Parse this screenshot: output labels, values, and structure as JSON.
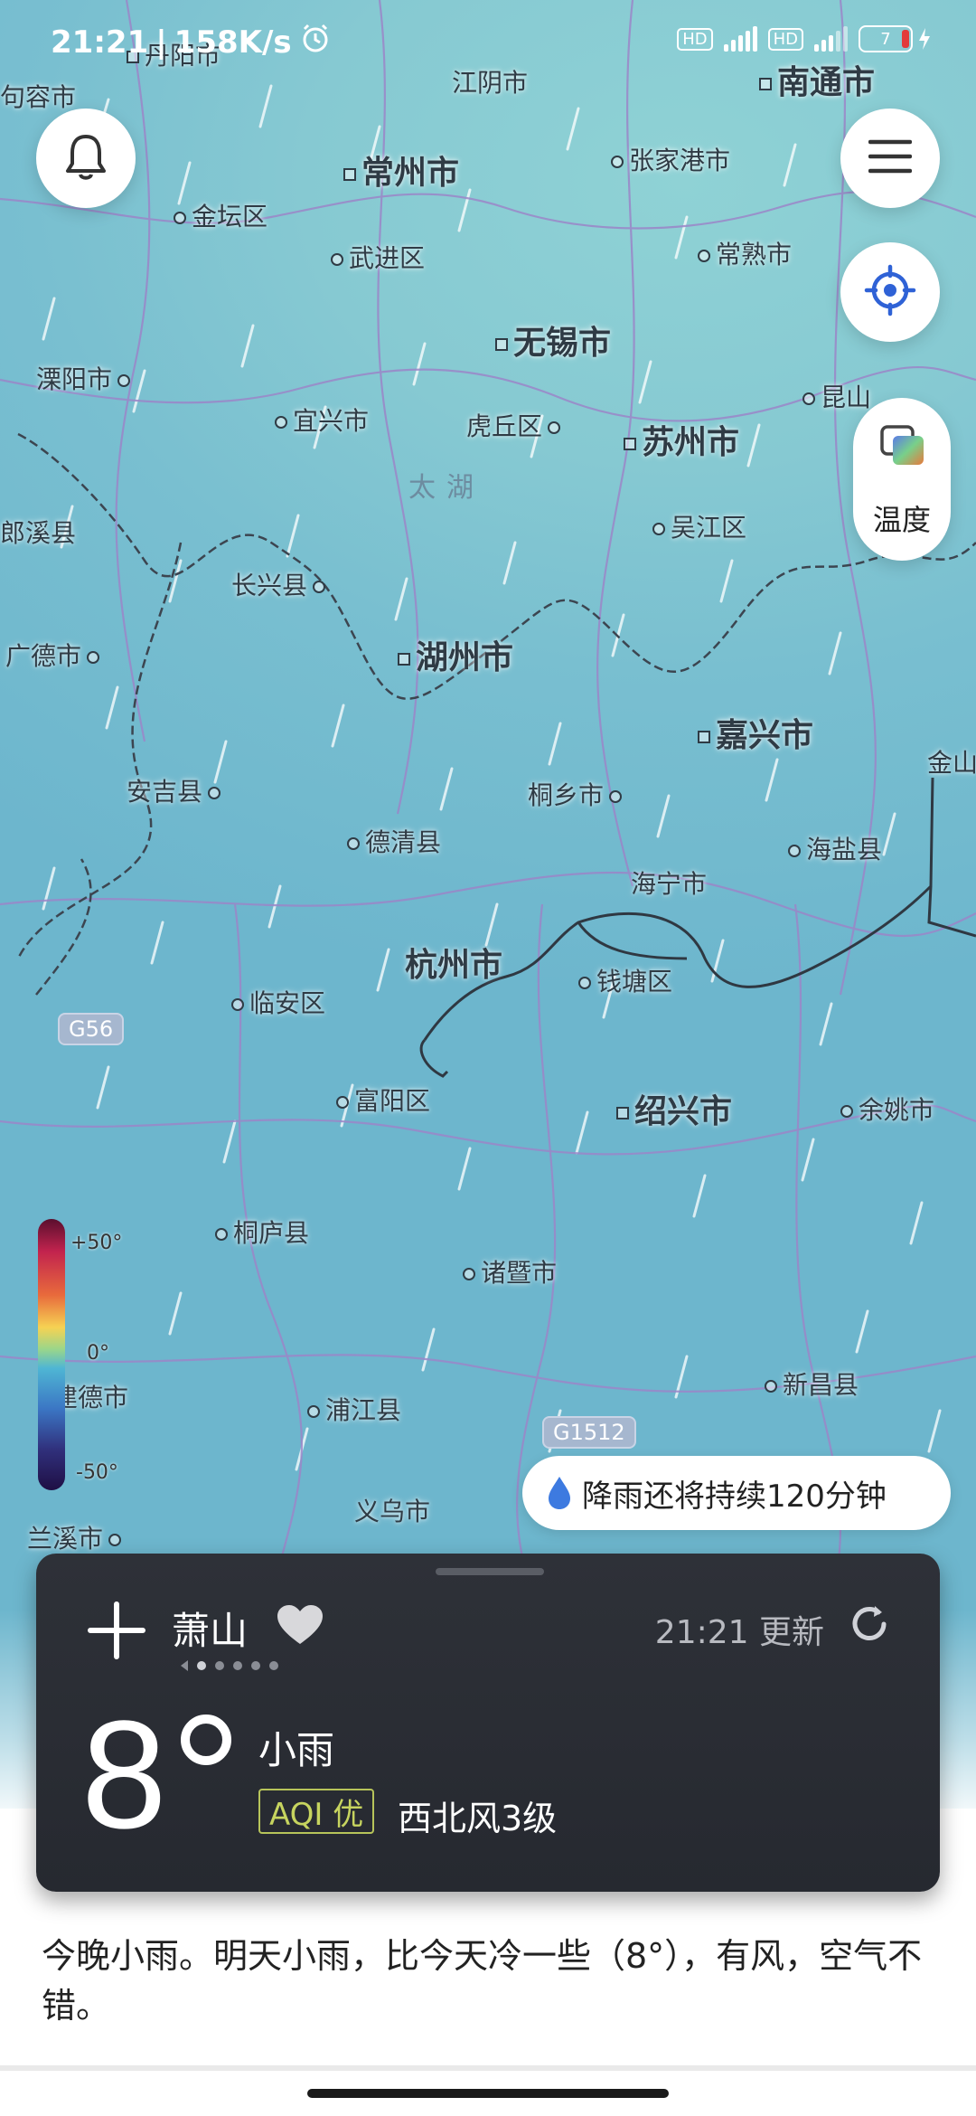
{
  "status_bar": {
    "time": "21:21",
    "speed": "158K/s",
    "battery": "7"
  },
  "map": {
    "places": [
      {
        "label": "丹阳市",
        "kind": "county"
      },
      {
        "label": "江阴市",
        "kind": "county"
      },
      {
        "label": "南通市",
        "kind": "city"
      },
      {
        "label": "句容市",
        "kind": "county"
      },
      {
        "label": "常州市",
        "kind": "city"
      },
      {
        "label": "张家港市",
        "kind": "county"
      },
      {
        "label": "金坛区",
        "kind": "county"
      },
      {
        "label": "武进区",
        "kind": "county"
      },
      {
        "label": "常熟市",
        "kind": "county"
      },
      {
        "label": "无锡市",
        "kind": "city"
      },
      {
        "label": "溧阳市",
        "kind": "county"
      },
      {
        "label": "宜兴市",
        "kind": "county"
      },
      {
        "label": "虎丘区",
        "kind": "county"
      },
      {
        "label": "苏州市",
        "kind": "city"
      },
      {
        "label": "昆山",
        "kind": "county"
      },
      {
        "label": "太湖",
        "kind": "lake"
      },
      {
        "label": "郎溪县",
        "kind": "county"
      },
      {
        "label": "吴江区",
        "kind": "county"
      },
      {
        "label": "长兴县",
        "kind": "county"
      },
      {
        "label": "广德市",
        "kind": "county"
      },
      {
        "label": "湖州市",
        "kind": "city"
      },
      {
        "label": "嘉兴市",
        "kind": "city"
      },
      {
        "label": "金山",
        "kind": "county"
      },
      {
        "label": "安吉县",
        "kind": "county"
      },
      {
        "label": "桐乡市",
        "kind": "county"
      },
      {
        "label": "德清县",
        "kind": "county"
      },
      {
        "label": "海盐县",
        "kind": "county"
      },
      {
        "label": "海宁市",
        "kind": "county"
      },
      {
        "label": "杭州市",
        "kind": "city"
      },
      {
        "label": "钱塘区",
        "kind": "county"
      },
      {
        "label": "临安区",
        "kind": "county"
      },
      {
        "label": "富阳区",
        "kind": "county"
      },
      {
        "label": "绍兴市",
        "kind": "city"
      },
      {
        "label": "余姚市",
        "kind": "county"
      },
      {
        "label": "桐庐县",
        "kind": "county"
      },
      {
        "label": "诸暨市",
        "kind": "county"
      },
      {
        "label": "建德市",
        "kind": "county"
      },
      {
        "label": "新昌县",
        "kind": "county"
      },
      {
        "label": "浦江县",
        "kind": "county"
      },
      {
        "label": "义乌市",
        "kind": "county"
      },
      {
        "label": "兰溪市",
        "kind": "county"
      }
    ],
    "roads": [
      "G56",
      "G1512"
    ],
    "legend": {
      "top": "+50°",
      "mid": "0°",
      "bottom": "-50°"
    }
  },
  "controls": {
    "layer_label": "温度",
    "icons": [
      "bell-icon",
      "menu-icon",
      "locate-icon",
      "layers-icon"
    ]
  },
  "rain_notice": "降雨还将持续120分钟",
  "card": {
    "city": "萧山",
    "updated": "21:21 更新",
    "temp": "8",
    "condition": "小雨",
    "aqi": "AQI 优",
    "wind": "西北风3级"
  },
  "forecast_text": "今晚小雨。明天小雨，比今天冷一些（8°），有风，空气不错。"
}
